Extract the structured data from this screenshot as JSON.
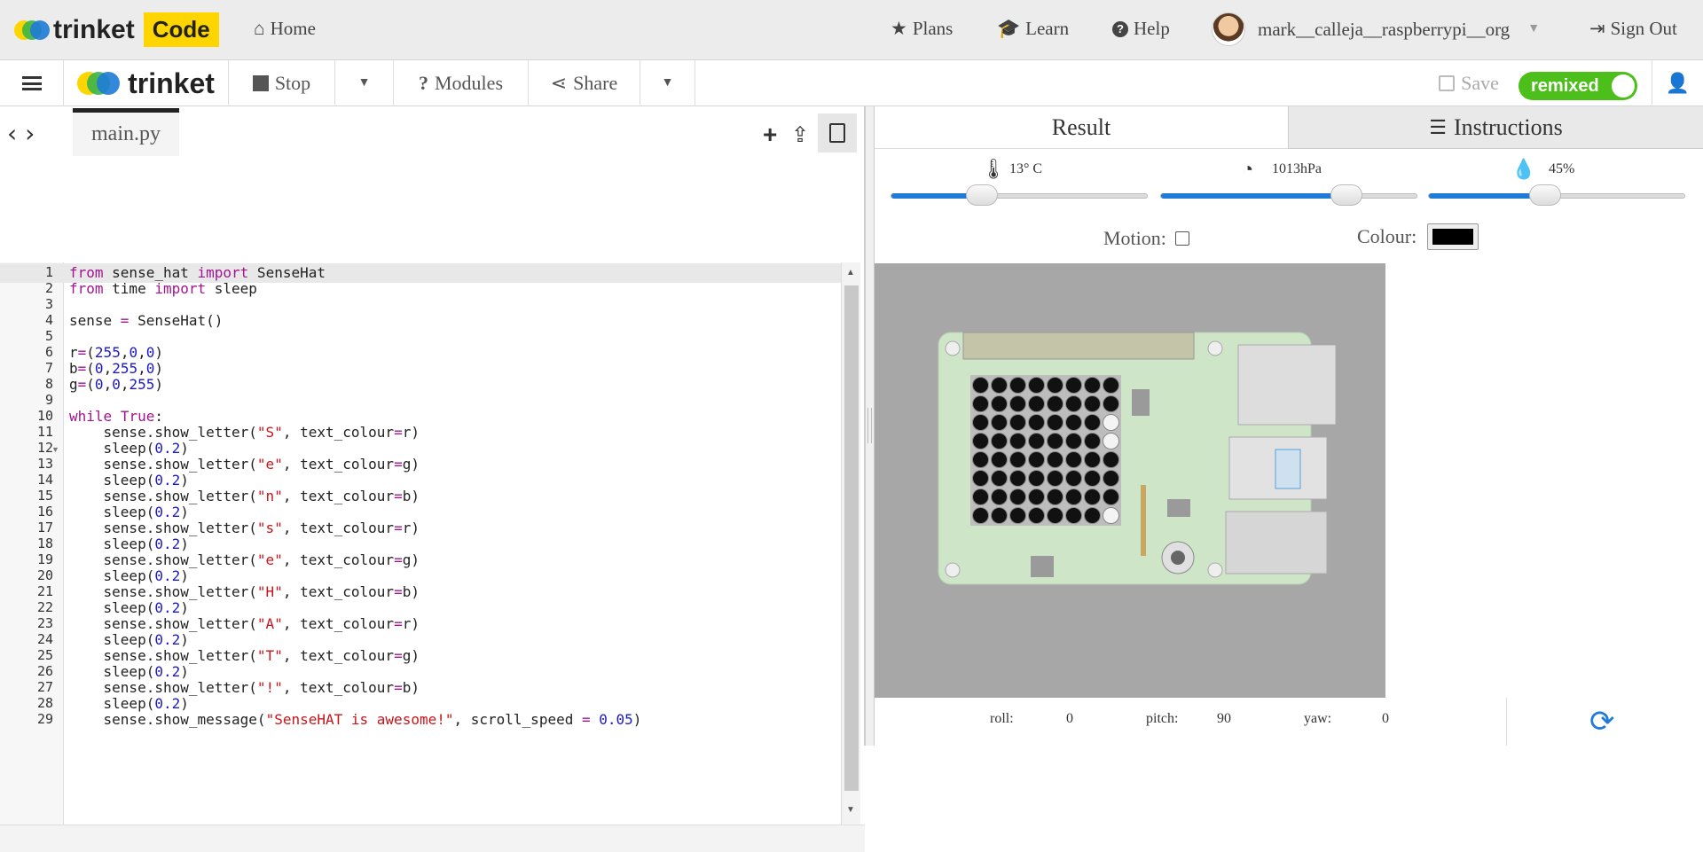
{
  "topnav": {
    "brand_text": "trinket",
    "brand_badge": "Code",
    "home": "Home",
    "plans": "Plans",
    "learn": "Learn",
    "help": "Help",
    "username": "mark__calleja__raspberrypi__org",
    "signout": "Sign Out"
  },
  "toolbar": {
    "logo_text": "trinket",
    "stop": "Stop",
    "modules": "Modules",
    "share": "Share",
    "save": "Save",
    "remixed": "remixed"
  },
  "editor": {
    "tab": "main.py",
    "lines": [
      [
        [
          "kw",
          "from"
        ],
        [
          "t",
          " sense_hat "
        ],
        [
          "kw",
          "import"
        ],
        [
          "t",
          " SenseHat"
        ]
      ],
      [
        [
          "kw",
          "from"
        ],
        [
          "t",
          " time "
        ],
        [
          "kw",
          "import"
        ],
        [
          "t",
          " sleep"
        ]
      ],
      [],
      [
        [
          "t",
          "sense "
        ],
        [
          "op",
          "="
        ],
        [
          "t",
          " SenseHat()"
        ]
      ],
      [],
      [
        [
          "t",
          "r"
        ],
        [
          "op",
          "="
        ],
        [
          "t",
          "("
        ],
        [
          "num",
          "255"
        ],
        [
          "t",
          ","
        ],
        [
          "num",
          "0"
        ],
        [
          "t",
          ","
        ],
        [
          "num",
          "0"
        ],
        [
          "t",
          ")"
        ]
      ],
      [
        [
          "t",
          "b"
        ],
        [
          "op",
          "="
        ],
        [
          "t",
          "("
        ],
        [
          "num",
          "0"
        ],
        [
          "t",
          ","
        ],
        [
          "num",
          "255"
        ],
        [
          "t",
          ","
        ],
        [
          "num",
          "0"
        ],
        [
          "t",
          ")"
        ]
      ],
      [
        [
          "t",
          "g"
        ],
        [
          "op",
          "="
        ],
        [
          "t",
          "("
        ],
        [
          "num",
          "0"
        ],
        [
          "t",
          ","
        ],
        [
          "num",
          "0"
        ],
        [
          "t",
          ","
        ],
        [
          "num",
          "255"
        ],
        [
          "t",
          ")"
        ]
      ],
      [],
      [
        [
          "kw",
          "while"
        ],
        [
          "t",
          " "
        ],
        [
          "kw",
          "True"
        ],
        [
          "t",
          ":"
        ]
      ],
      [
        [
          "t",
          "    sense.show_letter("
        ],
        [
          "str",
          "\"S\""
        ],
        [
          "t",
          ", text_colour"
        ],
        [
          "op",
          "="
        ],
        [
          "t",
          "r)"
        ]
      ],
      [
        [
          "t",
          "    sleep("
        ],
        [
          "num",
          "0.2"
        ],
        [
          "t",
          ")"
        ]
      ],
      [
        [
          "t",
          "    sense.show_letter("
        ],
        [
          "str",
          "\"e\""
        ],
        [
          "t",
          ", text_colour"
        ],
        [
          "op",
          "="
        ],
        [
          "t",
          "g)"
        ]
      ],
      [
        [
          "t",
          "    sleep("
        ],
        [
          "num",
          "0.2"
        ],
        [
          "t",
          ")"
        ]
      ],
      [
        [
          "t",
          "    sense.show_letter("
        ],
        [
          "str",
          "\"n\""
        ],
        [
          "t",
          ", text_colour"
        ],
        [
          "op",
          "="
        ],
        [
          "t",
          "b)"
        ]
      ],
      [
        [
          "t",
          "    sleep("
        ],
        [
          "num",
          "0.2"
        ],
        [
          "t",
          ")"
        ]
      ],
      [
        [
          "t",
          "    sense.show_letter("
        ],
        [
          "str",
          "\"s\""
        ],
        [
          "t",
          ", text_colour"
        ],
        [
          "op",
          "="
        ],
        [
          "t",
          "r)"
        ]
      ],
      [
        [
          "t",
          "    sleep("
        ],
        [
          "num",
          "0.2"
        ],
        [
          "t",
          ")"
        ]
      ],
      [
        [
          "t",
          "    sense.show_letter("
        ],
        [
          "str",
          "\"e\""
        ],
        [
          "t",
          ", text_colour"
        ],
        [
          "op",
          "="
        ],
        [
          "t",
          "g)"
        ]
      ],
      [
        [
          "t",
          "    sleep("
        ],
        [
          "num",
          "0.2"
        ],
        [
          "t",
          ")"
        ]
      ],
      [
        [
          "t",
          "    sense.show_letter("
        ],
        [
          "str",
          "\"H\""
        ],
        [
          "t",
          ", text_colour"
        ],
        [
          "op",
          "="
        ],
        [
          "t",
          "b)"
        ]
      ],
      [
        [
          "t",
          "    sleep("
        ],
        [
          "num",
          "0.2"
        ],
        [
          "t",
          ")"
        ]
      ],
      [
        [
          "t",
          "    sense.show_letter("
        ],
        [
          "str",
          "\"A\""
        ],
        [
          "t",
          ", text_colour"
        ],
        [
          "op",
          "="
        ],
        [
          "t",
          "r)"
        ]
      ],
      [
        [
          "t",
          "    sleep("
        ],
        [
          "num",
          "0.2"
        ],
        [
          "t",
          ")"
        ]
      ],
      [
        [
          "t",
          "    sense.show_letter("
        ],
        [
          "str",
          "\"T\""
        ],
        [
          "t",
          ", text_colour"
        ],
        [
          "op",
          "="
        ],
        [
          "t",
          "g)"
        ]
      ],
      [
        [
          "t",
          "    sleep("
        ],
        [
          "num",
          "0.2"
        ],
        [
          "t",
          ")"
        ]
      ],
      [
        [
          "t",
          "    sense.show_letter("
        ],
        [
          "str",
          "\"!\""
        ],
        [
          "t",
          ", text_colour"
        ],
        [
          "op",
          "="
        ],
        [
          "t",
          "b)"
        ]
      ],
      [
        [
          "t",
          "    sleep("
        ],
        [
          "num",
          "0.2"
        ],
        [
          "t",
          ")"
        ]
      ],
      [
        [
          "t",
          "    sense.show_message("
        ],
        [
          "str",
          "\"SenseHAT is awesome!\""
        ],
        [
          "t",
          ", scroll_speed "
        ],
        [
          "op",
          "="
        ],
        [
          "t",
          " "
        ],
        [
          "num",
          "0.05"
        ],
        [
          "t",
          ")"
        ]
      ]
    ]
  },
  "result": {
    "tab_result": "Result",
    "tab_instructions": "Instructions",
    "temperature": "13° C",
    "temperature_level": 0.35,
    "pressure": "1013hPa",
    "pressure_level": 0.72,
    "humidity": "45%",
    "humidity_level": 0.45,
    "motion_label": "Motion:",
    "motion_checked": false,
    "colour_label": "Colour:",
    "colour_value": "#000000",
    "roll_label": "roll:",
    "roll": "0",
    "pitch_label": "pitch:",
    "pitch": "90",
    "yaw_label": "yaw:",
    "yaw": "0"
  },
  "led_matrix": [
    [
      0,
      0,
      0,
      0,
      0,
      0,
      0,
      0
    ],
    [
      0,
      0,
      0,
      0,
      0,
      0,
      0,
      0
    ],
    [
      0,
      0,
      0,
      0,
      0,
      0,
      0,
      1
    ],
    [
      0,
      0,
      0,
      0,
      0,
      0,
      0,
      1
    ],
    [
      0,
      0,
      0,
      0,
      0,
      0,
      0,
      0
    ],
    [
      0,
      0,
      0,
      0,
      0,
      0,
      0,
      0
    ],
    [
      0,
      0,
      0,
      0,
      0,
      0,
      0,
      0
    ],
    [
      0,
      0,
      0,
      0,
      0,
      0,
      0,
      1
    ]
  ],
  "colors": {
    "accent_blue": "#1e7bd6",
    "toggle_green": "#4cbf1a",
    "badge_yellow": "#ffd500",
    "board_green": "#cfe5c8"
  }
}
